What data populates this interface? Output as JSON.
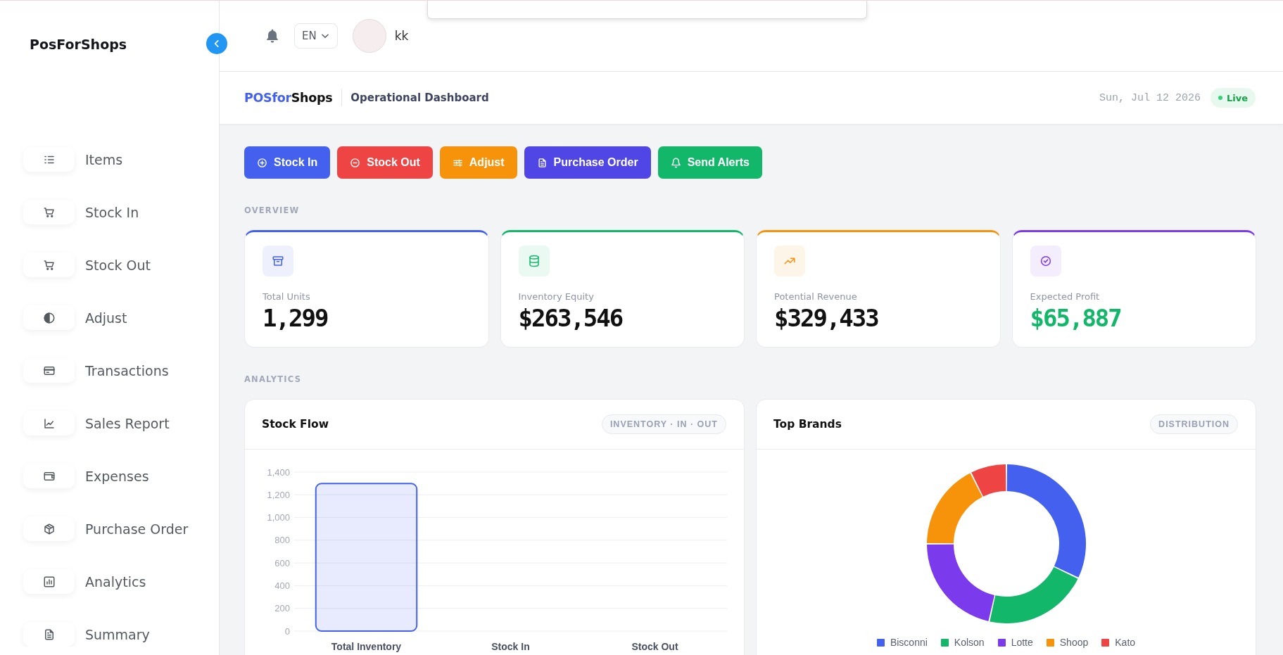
{
  "sidebar": {
    "title": "PosForShops",
    "items": [
      {
        "label": "Items",
        "selected": false
      },
      {
        "label": "Stock In",
        "selected": false
      },
      {
        "label": "Stock Out",
        "selected": false
      },
      {
        "label": "Adjust",
        "selected": false
      },
      {
        "label": "Transactions",
        "selected": false
      },
      {
        "label": "Sales Report",
        "selected": false
      },
      {
        "label": "Expenses",
        "selected": false
      },
      {
        "label": "Purchase Order",
        "selected": false
      },
      {
        "label": "Analytics",
        "selected": false
      },
      {
        "label": "Summary",
        "selected": false
      }
    ]
  },
  "topbar": {
    "language": "EN",
    "username": "kk"
  },
  "subheader": {
    "brand_accent": "POSfor",
    "brand_rest": "Shops",
    "title": "Operational Dashboard",
    "date": "Sun, Jul 12 2026",
    "status": "Live"
  },
  "actions": [
    {
      "label": "Stock In",
      "color": "#4361ee"
    },
    {
      "label": "Stock Out",
      "color": "#ef4444"
    },
    {
      "label": "Adjust",
      "color": "#f7930b"
    },
    {
      "label": "Purchase Order",
      "color": "#4f46e5"
    },
    {
      "label": "Send Alerts",
      "color": "#12b76a"
    }
  ],
  "overview": {
    "heading": "OVERVIEW",
    "cards": [
      {
        "label": "Total Units",
        "value": "1,299",
        "color": "#4361ee",
        "positive": false
      },
      {
        "label": "Inventory Equity",
        "value": "$263,546",
        "color": "#12b76a",
        "positive": false
      },
      {
        "label": "Potential Revenue",
        "value": "$329,433",
        "color": "#f7930b",
        "positive": false
      },
      {
        "label": "Expected Profit",
        "value": "$65,887",
        "color": "#7c3aed",
        "positive": true
      }
    ]
  },
  "analytics": {
    "heading": "ANALYTICS",
    "stock_flow": {
      "title": "Stock Flow",
      "tag": "INVENTORY · IN · OUT",
      "chart_data": {
        "type": "bar",
        "categories": [
          "Total Inventory",
          "Stock In",
          "Stock Out"
        ],
        "series": [
          {
            "color": "#4361ee",
            "values": [
              1299,
              0,
              0
            ]
          }
        ],
        "ylim": [
          0,
          1400
        ],
        "yticks": [
          0,
          200,
          400,
          600,
          800,
          {
            "value": 1000,
            "label": "1,000"
          },
          {
            "value": 1200,
            "label": "1,200"
          },
          {
            "value": 1400,
            "label": "1,400"
          }
        ],
        "grid": true
      }
    },
    "top_brands": {
      "title": "Top Brands",
      "tag": "DISTRIBUTION",
      "legend": [
        {
          "label": "Bisconni",
          "color": "#4361ee"
        },
        {
          "label": "Kolson",
          "color": "#12b76a"
        },
        {
          "label": "Lotte",
          "color": "#7c3aed"
        },
        {
          "label": "Shoop",
          "color": "#f7930b"
        },
        {
          "label": "Kato",
          "color": "#ef4444"
        }
      ]
    }
  }
}
